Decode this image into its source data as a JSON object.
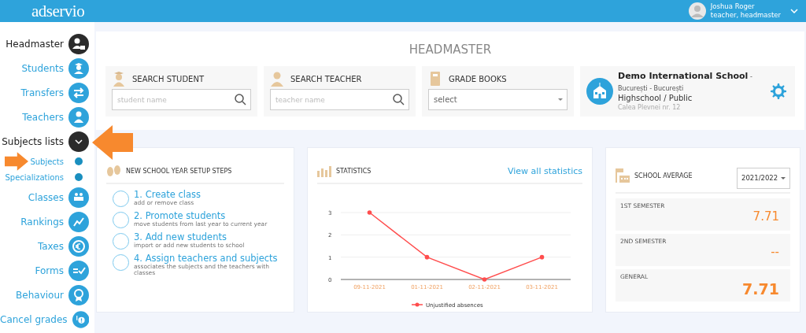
{
  "header": {
    "logo": "adservio",
    "user": {
      "name": "Joshua Roger",
      "role": "teacher, headmaster"
    }
  },
  "sidebar": {
    "items": [
      {
        "label": "Headmaster",
        "selected": true
      },
      {
        "label": "Students",
        "selected": false
      },
      {
        "label": "Transfers",
        "selected": false
      },
      {
        "label": "Teachers",
        "selected": false
      },
      {
        "label": "Subjects lists",
        "selected": true,
        "expanded": true,
        "children": [
          {
            "label": "Subjects"
          },
          {
            "label": "Specializations"
          }
        ]
      },
      {
        "label": "Classes",
        "selected": false
      },
      {
        "label": "Rankings",
        "selected": false
      },
      {
        "label": "Taxes",
        "selected": false
      },
      {
        "label": "Forms",
        "selected": false
      },
      {
        "label": "Behaviour",
        "selected": false
      },
      {
        "label": "Cancel grades",
        "selected": false
      }
    ]
  },
  "page_title": "HEADMASTER",
  "search_cards": [
    {
      "kind": "search",
      "title": "SEARCH STUDENT",
      "placeholder": "student name"
    },
    {
      "kind": "search",
      "title": "SEARCH TEACHER",
      "placeholder": "teacher name"
    },
    {
      "kind": "select",
      "title": "GRADE BOOKS",
      "value": "select"
    }
  ],
  "school": {
    "name": "Demo International School",
    "location": "- București - București",
    "type": "Highschool / Public",
    "address": "Calea Plevnei nr. 12"
  },
  "setup": {
    "title": "NEW SCHOOL YEAR SETUP STEPS",
    "steps": [
      {
        "title": "1. Create class",
        "description": "add or remove class",
        "done": false
      },
      {
        "title": "2. Promote students",
        "description": "move students from last year to current year",
        "done": false
      },
      {
        "title": "3. Add new students",
        "description": "import or add new students to school",
        "done": false
      },
      {
        "title": "4. Assign teachers and subjects",
        "description": "associates the subjects and the teachers with classes",
        "done": false
      }
    ]
  },
  "statistics": {
    "title": "STATISTICS",
    "link": "View all statistics",
    "chart_data": {
      "type": "line",
      "categories": [
        "09-11-2021",
        "01-11-2021",
        "02-11-2021",
        "03-11-2021"
      ],
      "series": [
        {
          "name": "Unjustified absences",
          "color": "#ff4d4d",
          "values": [
            3,
            1,
            0,
            1
          ]
        }
      ],
      "yticks": [
        0,
        1,
        2,
        3
      ],
      "ylim": [
        0,
        3
      ]
    }
  },
  "average": {
    "title": "SCHOOL AVERAGE",
    "year": "2021/2022",
    "rows": [
      {
        "kind": "normal",
        "label": "1ST SEMESTER",
        "value": "7.71"
      },
      {
        "kind": "normal",
        "label": "2ND SEMESTER",
        "value": "--"
      },
      {
        "kind": "total",
        "label": "GENERAL",
        "value": "7.71"
      }
    ]
  }
}
